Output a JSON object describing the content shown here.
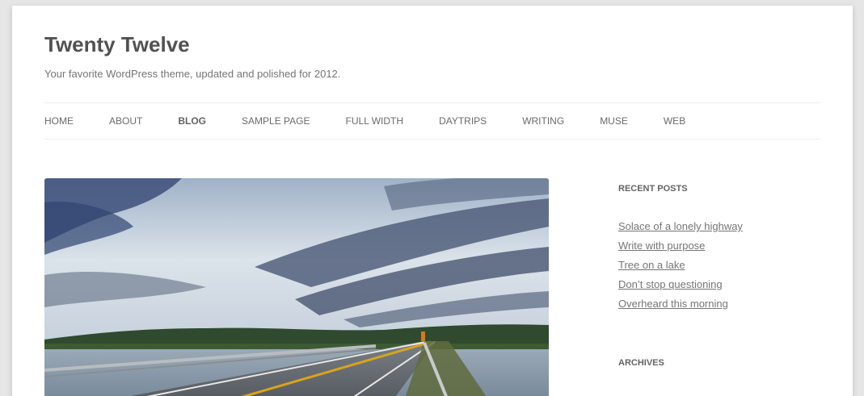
{
  "site": {
    "title": "Twenty Twelve",
    "description": "Your favorite WordPress theme, updated and polished for 2012."
  },
  "nav": {
    "items": [
      {
        "label": "HOME",
        "current": false
      },
      {
        "label": "ABOUT",
        "current": false
      },
      {
        "label": "BLOG",
        "current": true
      },
      {
        "label": "SAMPLE PAGE",
        "current": false
      },
      {
        "label": "FULL WIDTH",
        "current": false
      },
      {
        "label": "DAYTRIPS",
        "current": false
      },
      {
        "label": "WRITING",
        "current": false
      },
      {
        "label": "MUSE",
        "current": false
      },
      {
        "label": "WEB",
        "current": false
      }
    ]
  },
  "featured_image": {
    "subject": "highway-causeway-over-lake-under-dramatic-clouds"
  },
  "sidebar": {
    "recent_posts": {
      "title": "RECENT POSTS",
      "items": [
        "Solace of a lonely highway",
        "Write with purpose",
        "Tree on a lake",
        "Don’t stop questioning",
        "Overheard this morning"
      ]
    },
    "archives": {
      "title": "ARCHIVES"
    }
  },
  "colors": {
    "background": "#e6e6e6",
    "page": "#ffffff",
    "title": "#515151",
    "link": "#757575",
    "border": "#ededed"
  }
}
